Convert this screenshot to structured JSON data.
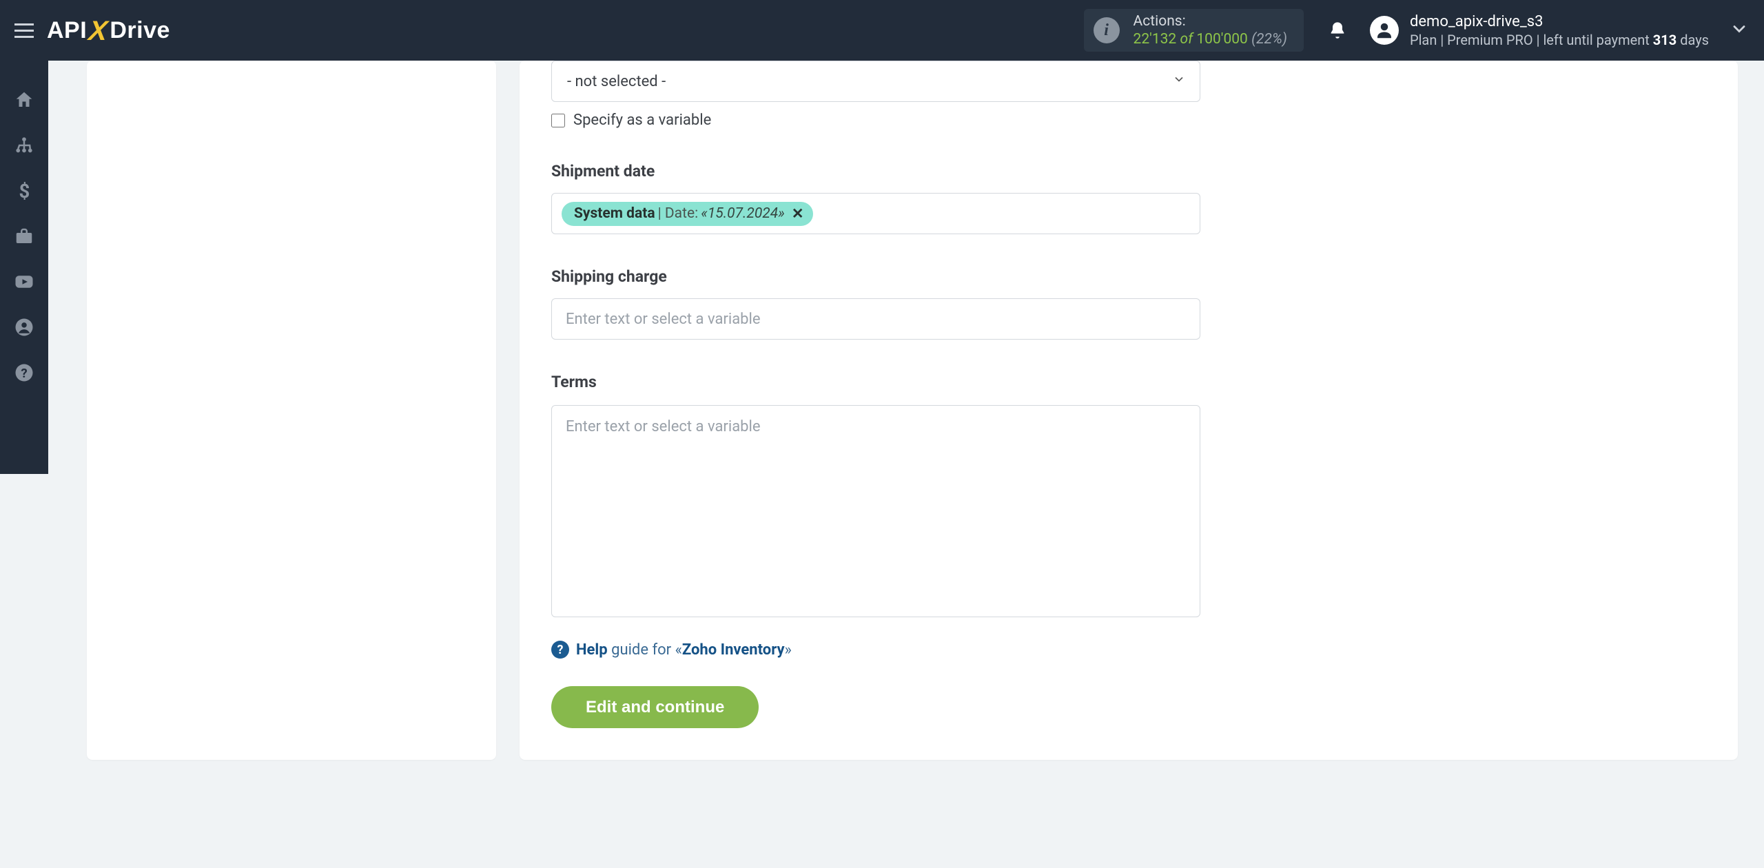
{
  "logo": {
    "part1": "API",
    "x": "X",
    "part2": "Drive"
  },
  "actions": {
    "label": "Actions:",
    "used": "22'132",
    "of": "of",
    "total": "100'000",
    "percent": "(22%)"
  },
  "user": {
    "name": "demo_apix-drive_s3",
    "plan_prefix": "Plan |",
    "plan_name": "Premium PRO",
    "plan_mid": "| left until payment",
    "plan_days_num": "313",
    "plan_days_suffix": "days"
  },
  "form": {
    "select_placeholder": "- not selected -",
    "specify_var": "Specify as a variable",
    "shipment_date_label": "Shipment date",
    "pill": {
      "sys": "System data",
      "sep": " | Date: ",
      "date": "«15.07.2024»"
    },
    "shipping_charge_label": "Shipping charge",
    "enter_placeholder": "Enter text or select a variable",
    "terms_label": "Terms"
  },
  "help": {
    "help": "Help",
    "guide": "guide for «",
    "target": "Zoho Inventory",
    "close": "»"
  },
  "buttons": {
    "edit_continue": "Edit and continue"
  }
}
